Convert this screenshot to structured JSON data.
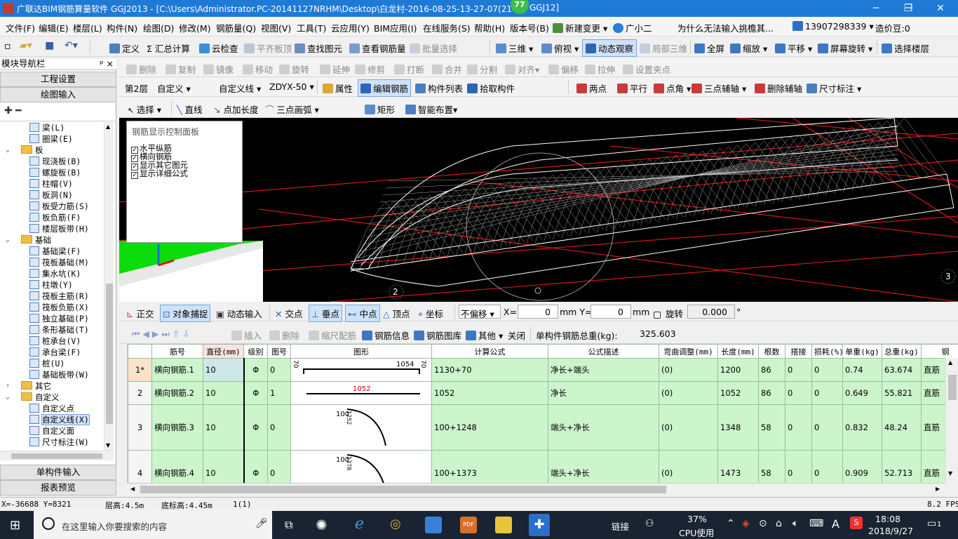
{
  "title": "广联达BIM钢筋算量软件 GGJ2013 - [C:\\Users\\Administrator.PC-20141127NRHM\\Desktop\\白龙村-2016-08-25-13-27-07(21",
  "title_suffix": "GGJ12]",
  "badge": "77",
  "window_controls": {
    "min": "─",
    "restore": "❐",
    "close": "✕"
  },
  "menu": [
    "文件(F)",
    "编辑(E)",
    "楼层(L)",
    "构件(N)",
    "绘图(D)",
    "修改(M)",
    "钢筋量(Q)",
    "视图(V)",
    "工具(T)",
    "云应用(Y)",
    "BIM应用(I)",
    "在线服务(S)",
    "帮助(H)",
    "版本号(B)",
    "新建变更 ▾",
    "广小二"
  ],
  "menu_question": "为什么无法输入挑檐其...",
  "menu_phone": "13907298339 ▾",
  "menu_bean": "造价豆:0",
  "toolbar1": [
    "定义",
    "Σ 汇总计算",
    "云检查",
    "平齐板顶",
    "查找图元",
    "查看钢筋量",
    "批量选择",
    "三维 ▾",
    "俯视 ▾",
    "动态观察",
    "局部三维",
    "全屏",
    "缩放 ▾",
    "平移 ▾",
    "屏幕旋转 ▾",
    "选择楼层"
  ],
  "toolbar2": [
    "删除",
    "复制",
    "镜像",
    "移动",
    "旋转",
    "延伸",
    "修剪",
    "打断",
    "合并",
    "分割",
    "对齐▾",
    "偏移",
    "拉伸",
    "设置夹点"
  ],
  "toolbar3": {
    "floor": "第2层",
    "type": "自定义",
    "sub": "自定义线",
    "code": "ZDYX-50",
    "items": [
      "属性",
      "编辑钢筋",
      "构件列表",
      "拾取构件"
    ],
    "right": [
      "两点",
      "平行",
      "点角 ▾",
      "三点辅轴 ▾",
      "删除辅轴",
      "尺寸标注 ▾"
    ]
  },
  "toolbar4": [
    "选择 ▾",
    "直线",
    "点加长度",
    "三点画弧 ▾",
    "矩形",
    "智能布置▾"
  ],
  "left_panel": {
    "header": "模块导航栏",
    "pin": "ᵖ ×",
    "engineering": "工程设置",
    "drawing": "绘图输入",
    "tree": [
      {
        "label": "梁(L)",
        "level": 2
      },
      {
        "label": "圈梁(E)",
        "level": 2
      },
      {
        "label": "板",
        "level": 1,
        "folder": true
      },
      {
        "label": "现浇板(B)",
        "level": 2
      },
      {
        "label": "螺旋板(B)",
        "level": 2
      },
      {
        "label": "柱帽(V)",
        "level": 2
      },
      {
        "label": "板洞(N)",
        "level": 2
      },
      {
        "label": "板受力筋(S)",
        "level": 2
      },
      {
        "label": "板负筋(F)",
        "level": 2
      },
      {
        "label": "楼层板带(H)",
        "level": 2
      },
      {
        "label": "基础",
        "level": 1,
        "folder": true
      },
      {
        "label": "基础梁(F)",
        "level": 2
      },
      {
        "label": "筏板基础(M)",
        "level": 2
      },
      {
        "label": "集水坑(K)",
        "level": 2
      },
      {
        "label": "柱墩(Y)",
        "level": 2
      },
      {
        "label": "筏板主筋(R)",
        "level": 2
      },
      {
        "label": "筏板负筋(X)",
        "level": 2
      },
      {
        "label": "独立基础(P)",
        "level": 2
      },
      {
        "label": "条形基础(T)",
        "level": 2
      },
      {
        "label": "桩承台(V)",
        "level": 2
      },
      {
        "label": "承台梁(F)",
        "level": 2
      },
      {
        "label": "桩(U)",
        "level": 2
      },
      {
        "label": "基础板带(W)",
        "level": 2
      },
      {
        "label": "其它",
        "level": 1,
        "folder": true,
        "collapsed": true
      },
      {
        "label": "自定义",
        "level": 1,
        "folder": true
      },
      {
        "label": "自定义点",
        "level": 2
      },
      {
        "label": "自定义线(X)",
        "level": 2,
        "selected": true
      },
      {
        "label": "自定义面",
        "level": 2
      },
      {
        "label": "尺寸标注(W)",
        "level": 2
      }
    ],
    "single": "单构件输入",
    "report": "报表预览"
  },
  "ctrl_panel": {
    "title": "钢筋显示控制面板",
    "items": [
      "水平纵筋",
      "横向钢筋",
      "显示其它图元",
      "显示详细公式"
    ]
  },
  "viewport_labels": [
    "2",
    "3"
  ],
  "snapbar": {
    "items": [
      "正交",
      "对象捕捉",
      "动态输入",
      "交点",
      "垂点",
      "中点",
      "顶点",
      "坐标"
    ],
    "offset": "不偏移",
    "x_label": "X=",
    "x_val": "0",
    "y_label": "mm Y=",
    "y_val": "0",
    "mm": "mm",
    "rotate": "旋转",
    "rot_val": "0.000",
    "deg": "°"
  },
  "gridtb": {
    "items": [
      "插入",
      "删除",
      "缩尺配筋",
      "钢筋信息",
      "钢筋图库",
      "其他 ▾",
      "关闭"
    ],
    "total_label": "单构件钢筋总重(kg):",
    "total": "325.603"
  },
  "grid": {
    "headers": [
      "",
      "筋号",
      "直径(mm)",
      "级别",
      "图号",
      "图形",
      "计算公式",
      "公式描述",
      "弯曲调整(mm)",
      "长度(mm)",
      "根数",
      "搭接",
      "损耗(%)",
      "单重(kg)",
      "总重(kg)",
      "钢"
    ],
    "rows": [
      {
        "no": "1*",
        "name": "横向钢筋.1",
        "dia": "10",
        "grade": "Φ",
        "fig": "0",
        "shape_top": "1054",
        "shape_l": "70",
        "shape_r": "70",
        "formula": "1130+70",
        "desc": "净长+端头",
        "bend": "(0)",
        "len": "1200",
        "cnt": "86",
        "lap": "0",
        "loss": "0",
        "unit": "0.74",
        "total": "63.674",
        "hook": "直筋"
      },
      {
        "no": "2",
        "name": "横向钢筋.2",
        "dia": "10",
        "grade": "Φ",
        "fig": "1",
        "shape_top": "1052",
        "formula": "1052",
        "desc": "净长",
        "bend": "(0)",
        "len": "1052",
        "cnt": "86",
        "lap": "0",
        "loss": "0",
        "unit": "0.649",
        "total": "55.821",
        "hook": "直筋"
      },
      {
        "no": "3",
        "name": "横向钢筋.3",
        "dia": "10",
        "grade": "Φ",
        "fig": "0",
        "shape_top": "100",
        "shape_arc": "1252",
        "formula": "100+1248",
        "desc": "端头+净长",
        "bend": "(0)",
        "len": "1348",
        "cnt": "58",
        "lap": "0",
        "loss": "0",
        "unit": "0.832",
        "total": "48.24",
        "hook": "直筋"
      },
      {
        "no": "4",
        "name": "横向钢筋.4",
        "dia": "10",
        "grade": "Φ",
        "fig": "0",
        "shape_top": "100",
        "shape_arc": "1378",
        "formula": "100+1373",
        "desc": "端头+净长",
        "bend": "(0)",
        "len": "1473",
        "cnt": "58",
        "lap": "0",
        "loss": "0",
        "unit": "0.909",
        "total": "52.713",
        "hook": "直筋"
      }
    ]
  },
  "status": {
    "coords": "X=-36688 Y=8321",
    "floor_h": "层高:4.5m",
    "bottom_h": "底标高:4.45m",
    "count": "1(1)",
    "fps": "8.2 FPS"
  },
  "taskbar": {
    "search": "在这里输入你要搜索的内容",
    "link": "链接",
    "cpu": "37%",
    "cpu_label": "CPU使用",
    "time": "18:08",
    "date": "2018/9/27",
    "ime": "A",
    "notif": "1"
  },
  "colors": {
    "title": "#1f7ad6",
    "grid_row": "#ccf5cc",
    "viewport": "#000000",
    "green": "#0bdc0b"
  }
}
